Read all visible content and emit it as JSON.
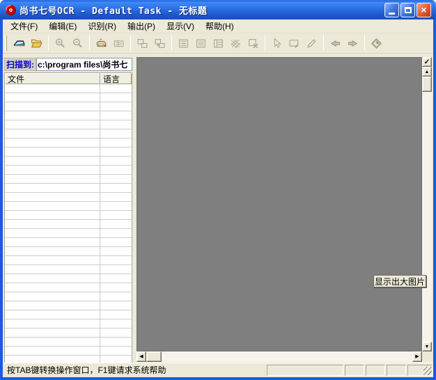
{
  "window": {
    "title": "尚书七号OCR - Default Task - 无标题",
    "app_icon": "hanvon-ocr-logo",
    "controls": [
      "minimize",
      "maximize",
      "close"
    ]
  },
  "menu": {
    "items": [
      "文件(F)",
      "编辑(E)",
      "识别(R)",
      "输出(P)",
      "显示(V)",
      "帮助(H)"
    ]
  },
  "toolbar": {
    "buttons": [
      {
        "icon": "scanner-icon",
        "action": "scan",
        "enabled": true
      },
      {
        "icon": "open-folder-icon",
        "action": "open",
        "enabled": true
      },
      {
        "icon": "zoom-in-icon",
        "action": "zoom-in",
        "enabled": false
      },
      {
        "icon": "zoom-out-icon",
        "action": "zoom-out",
        "enabled": false
      },
      {
        "icon": "recognize-icon",
        "action": "recognize",
        "enabled": true
      },
      {
        "icon": "form-recognize-icon",
        "action": "form-recognize",
        "enabled": false
      },
      {
        "icon": "tile-horizontal-icon",
        "action": "tile-horizontal",
        "enabled": false
      },
      {
        "icon": "tile-vertical-icon",
        "action": "tile-vertical",
        "enabled": false
      },
      {
        "icon": "horizontal-text-region-icon",
        "action": "horizontal-text-region",
        "enabled": false
      },
      {
        "icon": "vertical-text-region-icon",
        "action": "vertical-text-region",
        "enabled": false
      },
      {
        "icon": "table-region-icon",
        "action": "table-region",
        "enabled": false
      },
      {
        "icon": "image-region-icon",
        "action": "image-region",
        "enabled": false
      },
      {
        "icon": "delete-region-icon",
        "action": "delete-region",
        "enabled": false
      },
      {
        "icon": "select-arrow-icon",
        "action": "select",
        "enabled": false
      },
      {
        "icon": "edit-region-icon",
        "action": "edit-region",
        "enabled": false
      },
      {
        "icon": "pen-icon",
        "action": "draw-region",
        "enabled": false
      },
      {
        "icon": "arrow-left-icon",
        "action": "previous-page",
        "enabled": false
      },
      {
        "icon": "arrow-right-icon",
        "action": "next-page",
        "enabled": false
      },
      {
        "icon": "hanvon-diamond-icon",
        "action": "about",
        "enabled": false
      }
    ]
  },
  "left_panel": {
    "scan_to_label": "扫描到:",
    "scan_path": "c:\\program files\\尚书七",
    "table": {
      "columns": [
        "文件",
        "语言"
      ],
      "rows": [],
      "visible_empty_rows": 30
    }
  },
  "main_view": {
    "tooltip": "显示出大图片",
    "top_button_icon": "check-icon"
  },
  "statusbar": {
    "message": "按TAB键转换操作窗口，F1键请求系统帮助",
    "panels": 5
  },
  "colors": {
    "titlebar_blue": "#2D6FE4",
    "window_border_blue": "#1A5CDD",
    "face": "#ECE9D8",
    "canvas_gray": "#7F7F7F",
    "close_red": "#E1603C",
    "scan_label_blue": "#0000CD",
    "disabled_icon": "#ACA899"
  }
}
